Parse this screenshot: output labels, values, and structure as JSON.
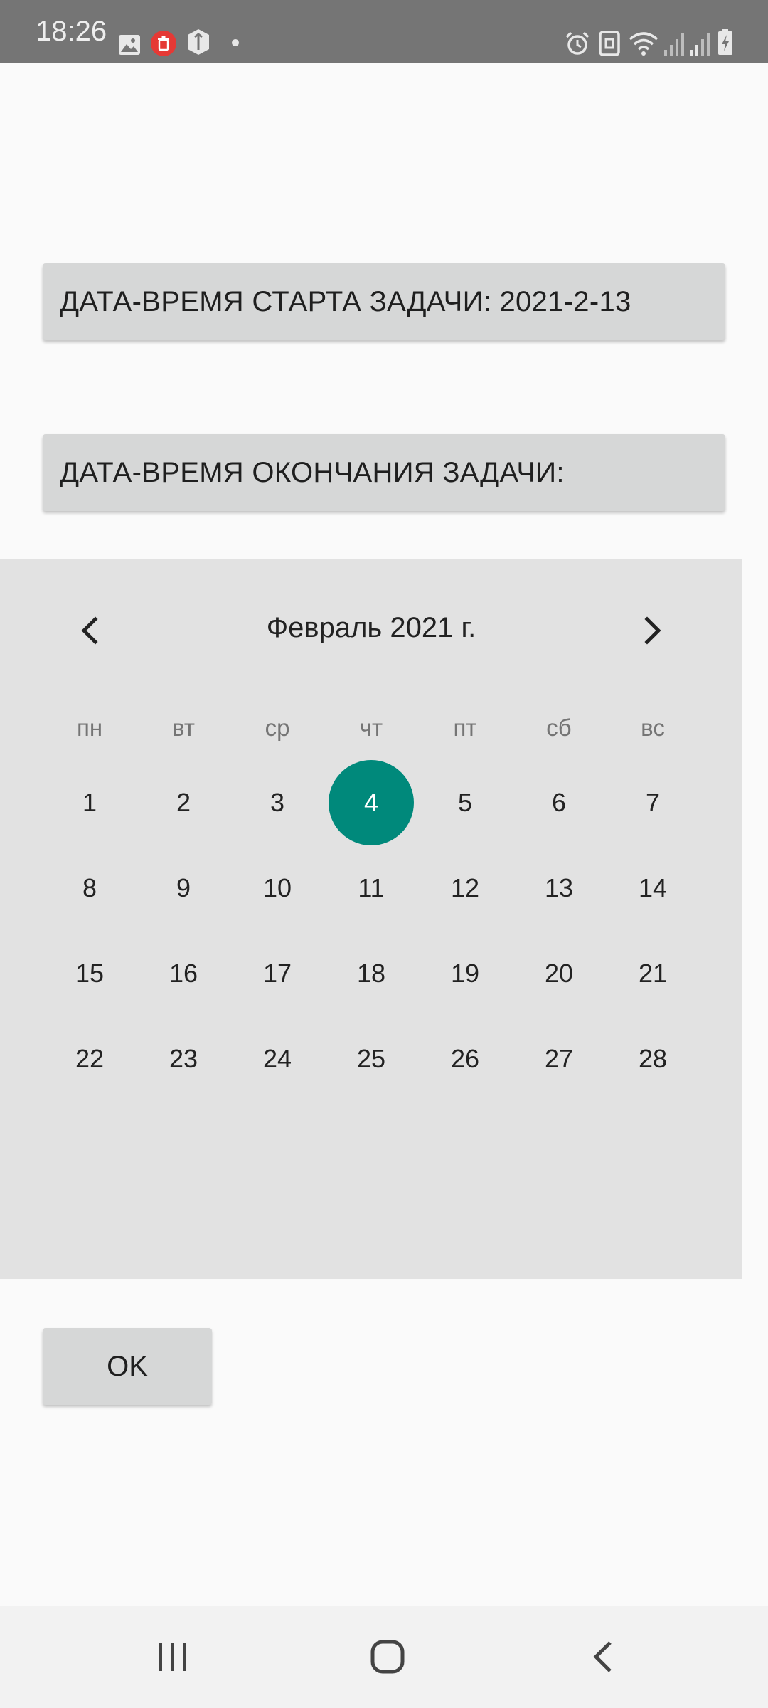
{
  "status_bar": {
    "time": "18:26",
    "left_icons": [
      "image-icon",
      "delete-notification-icon",
      "shield-icon",
      "dot-icon"
    ],
    "right_icons": [
      "alarm-icon",
      "nfc-icon",
      "wifi-icon",
      "signal-icon",
      "signal-icon",
      "battery-charging-icon"
    ]
  },
  "start_button": {
    "label": "ДАТА-ВРЕМЯ СТАРТА ЗАДАЧИ: 2021-2-13"
  },
  "end_button": {
    "label": "ДАТА-ВРЕМЯ ОКОНЧАНИЯ ЗАДАЧИ:"
  },
  "calendar": {
    "title": "Февраль 2021 г.",
    "weekdays": [
      "пн",
      "вт",
      "ср",
      "чт",
      "пт",
      "сб",
      "вс"
    ],
    "days": [
      "1",
      "2",
      "3",
      "4",
      "5",
      "6",
      "7",
      "8",
      "9",
      "10",
      "11",
      "12",
      "13",
      "14",
      "15",
      "16",
      "17",
      "18",
      "19",
      "20",
      "21",
      "22",
      "23",
      "24",
      "25",
      "26",
      "27",
      "28"
    ],
    "selected_day": "4",
    "accent_color": "#00897b",
    "prev_icon": "chevron-left-icon",
    "next_icon": "chevron-right-icon"
  },
  "ok_button": {
    "label": "OK"
  },
  "nav_bar": {
    "icons": [
      "recent-apps-icon",
      "home-icon",
      "back-icon"
    ]
  }
}
